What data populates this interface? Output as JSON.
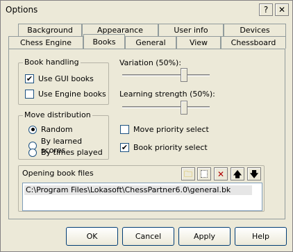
{
  "window": {
    "title": "Options"
  },
  "titlebar_buttons": {
    "help": "?",
    "close": "✕"
  },
  "tabs": {
    "row_top": [
      "Background",
      "Appearance",
      "User info",
      "Devices"
    ],
    "row_bottom": [
      "Chess Engine",
      "Books",
      "General",
      "View",
      "Chessboard"
    ],
    "active": "Books"
  },
  "book_handling": {
    "label": "Book handling",
    "use_gui_books": {
      "label": "Use GUI books",
      "checked": true
    },
    "use_engine_books": {
      "label": "Use Engine books",
      "checked": false
    }
  },
  "move_distribution": {
    "label": "Move distribution",
    "options": [
      "Random",
      "By learned scores",
      "By times played"
    ],
    "selected": "Random"
  },
  "variation": {
    "label": "Variation (50%):",
    "value": 50
  },
  "learning_strength": {
    "label": "Learning strength (50%):",
    "value": 50
  },
  "move_priority_select": {
    "label": "Move priority select",
    "checked": false
  },
  "book_priority_select": {
    "label": "Book priority select",
    "checked": true
  },
  "opening_book_files": {
    "label": "Opening book files",
    "toolbar_icons": [
      "open-folder-icon",
      "new-file-icon",
      "delete-icon",
      "move-up-icon",
      "move-down-icon"
    ],
    "files": [
      "C:\\Program Files\\Lokasoft\\ChessPartner6.0\\general.bk"
    ]
  },
  "buttons": {
    "ok": "OK",
    "cancel": "Cancel",
    "apply": "Apply",
    "help": "Help"
  },
  "colors": {
    "accent": "#1c5180",
    "panel": "#ece9d8"
  }
}
